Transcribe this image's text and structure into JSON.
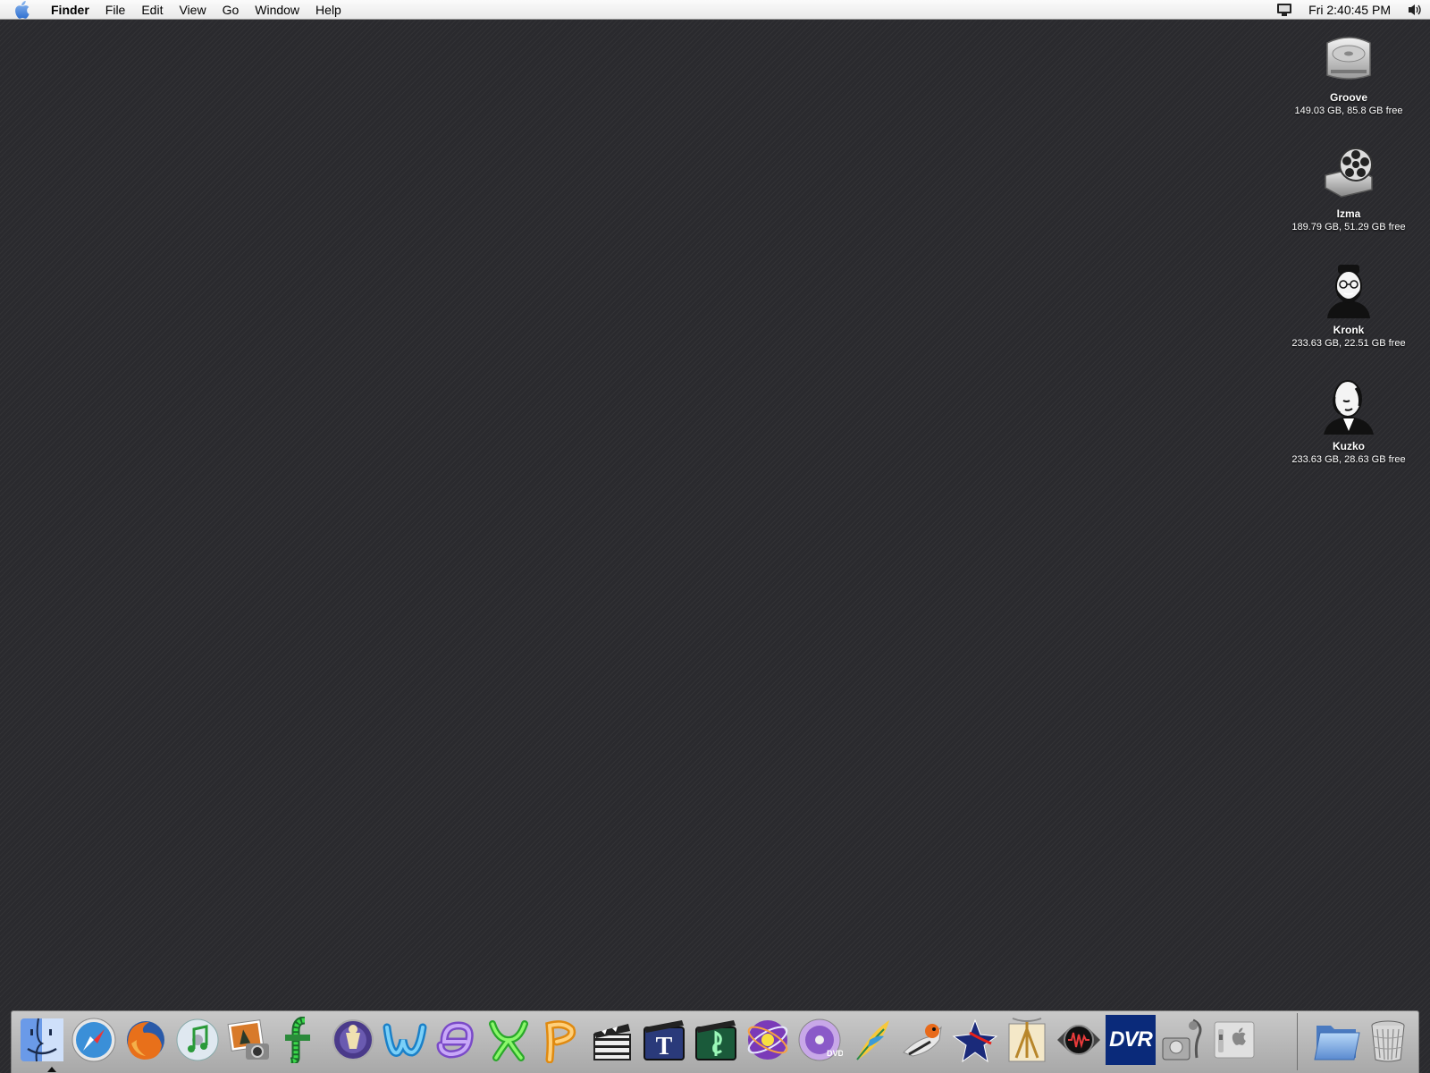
{
  "menubar": {
    "app_name": "Finder",
    "items": [
      "File",
      "Edit",
      "View",
      "Go",
      "Window",
      "Help"
    ],
    "clock": "Fri 2:40:45 PM"
  },
  "desktop": {
    "volumes": [
      {
        "name": "Groove",
        "info": "149.03 GB, 85.8 GB free",
        "icon": "hard-drive-icon"
      },
      {
        "name": "Izma",
        "info": "189.79 GB, 51.29 GB free",
        "icon": "film-reel-drive-icon"
      },
      {
        "name": "Kronk",
        "info": "233.63 GB, 22.51 GB free",
        "icon": "bearded-man-portrait-icon"
      },
      {
        "name": "Kuzko",
        "info": "233.63 GB, 28.63 GB free",
        "icon": "bald-man-portrait-icon"
      }
    ]
  },
  "dock": {
    "apps": [
      "finder-icon",
      "safari-icon",
      "firefox-icon",
      "itunes-icon",
      "iphoto-icon",
      "final-cut-icon",
      "app-icon",
      "word-icon",
      "entourage-icon",
      "excel-icon",
      "powerpoint-icon",
      "clapperboard-icon",
      "livetype-icon",
      "soundtrack-icon",
      "motion-icon",
      "dvd-studio-icon",
      "quill-icon",
      "bird-icon",
      "star-icon",
      "acrobat-icon",
      "audio-icon",
      "dvr-icon",
      "disk-utility-icon",
      "system-prefs-icon"
    ],
    "dvr_label": "DVR",
    "right_items": [
      "folder-icon",
      "trash-icon"
    ],
    "colors": {
      "finder": "#4a7fd4",
      "safari": "#3a8fd8",
      "firefox": "#e8701a",
      "itunes": "#a8c9e8",
      "iphoto": "#6a8a4a",
      "final_cut": "#2a8a3a",
      "word": "#3ab0e8",
      "entourage": "#9a6ad8",
      "excel": "#4ad838",
      "powerpoint": "#f0a020",
      "dvr": "#0a2a7a"
    }
  }
}
